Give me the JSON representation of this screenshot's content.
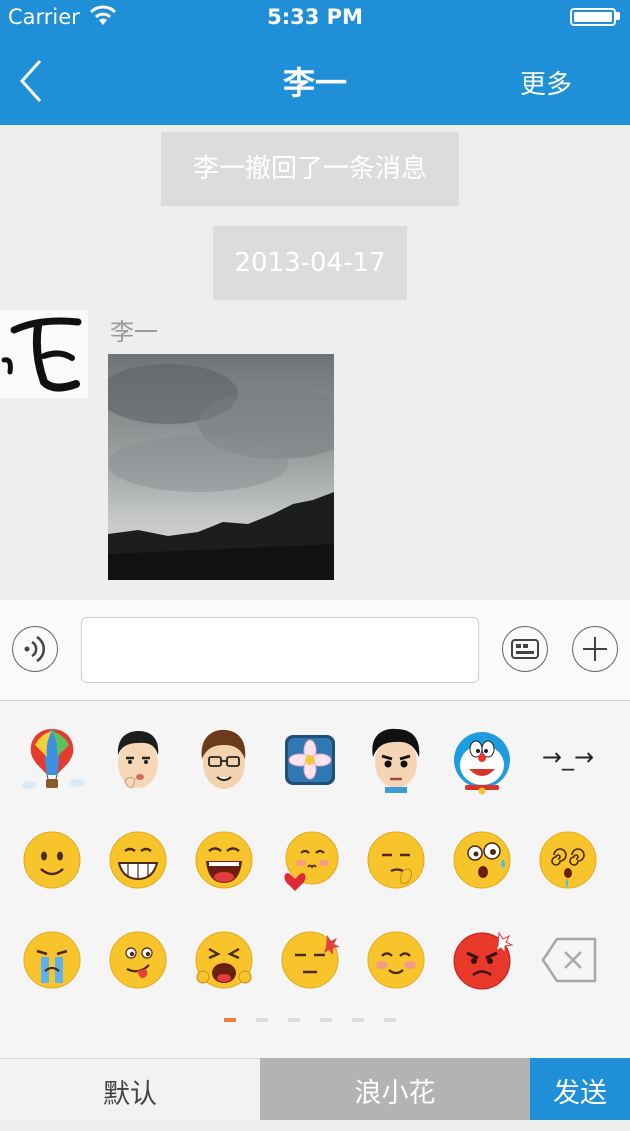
{
  "status": {
    "carrier": "Carrier",
    "time": "5:33 PM"
  },
  "nav": {
    "title": "李一",
    "more": "更多"
  },
  "chat": {
    "recall_notice": "李一撤回了一条消息",
    "date": "2013-04-17",
    "sender": "李一"
  },
  "emoji_rows": [
    [
      "hot-air-balloon",
      "man-kiss-face",
      "glasses-man",
      "lotus-flower",
      "angry-boy",
      "doraemon",
      "arrow-kaomoji"
    ],
    [
      "smile",
      "grin",
      "laugh",
      "shy-heart",
      "smirk-finger",
      "surprised-sweat",
      "dizzy"
    ],
    [
      "crying",
      "tongue-out",
      "bawling",
      "annoyed",
      "blush",
      "furious",
      "delete"
    ]
  ],
  "arrow_kaomoji": "→_→",
  "page_count": 6,
  "active_page": 1,
  "tabs": {
    "default": "默认",
    "lang": "浪小花",
    "send": "发送"
  },
  "colors": {
    "brand": "#1f8fd8",
    "page_indicator_active": "#ef7f3a"
  }
}
